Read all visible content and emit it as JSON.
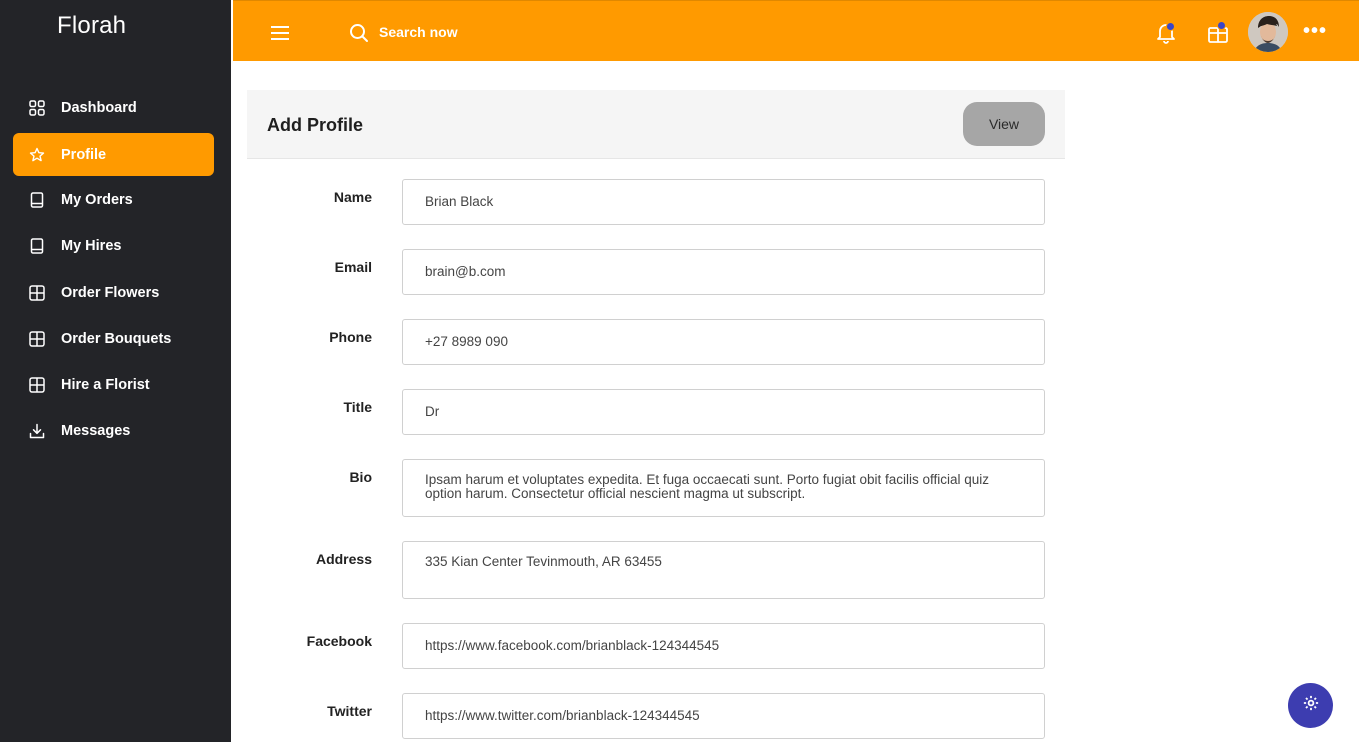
{
  "app": {
    "brand": "Florah"
  },
  "sidebar": {
    "items": [
      {
        "label": "Dashboard",
        "icon": "dashboard-grid-icon",
        "active": false
      },
      {
        "label": "Profile",
        "icon": "star-icon",
        "active": true
      },
      {
        "label": "My Orders",
        "icon": "book-icon",
        "active": false
      },
      {
        "label": "My Hires",
        "icon": "book-icon",
        "active": false
      },
      {
        "label": "Order Flowers",
        "icon": "grid-icon",
        "active": false
      },
      {
        "label": "Order Bouquets",
        "icon": "grid-icon",
        "active": false
      },
      {
        "label": "Hire a Florist",
        "icon": "grid-icon",
        "active": false
      },
      {
        "label": "Messages",
        "icon": "download-icon",
        "active": false
      }
    ]
  },
  "topbar": {
    "search_placeholder": "Search now",
    "more_label": "•••",
    "accent_color": "#ff9a00",
    "badge_color": "#3a45c8"
  },
  "card": {
    "title": "Add Profile",
    "view_button": "View"
  },
  "form": {
    "name": {
      "label": "Name",
      "value": "Brian Black"
    },
    "email": {
      "label": "Email",
      "value": "brain@b.com"
    },
    "phone": {
      "label": "Phone",
      "value": "+27 8989 090"
    },
    "title": {
      "label": "Title",
      "value": "Dr"
    },
    "bio": {
      "label": "Bio",
      "value": " Ipsam harum et voluptates expedita. Et fuga occaecati sunt. Porto fugiat obit facilis official quiz option harum. Consectetur official nescient magma ut subscript."
    },
    "address": {
      "label": "Address",
      "value": "335 Kian Center Tevinmouth, AR 63455"
    },
    "facebook": {
      "label": "Facebook",
      "value": "https://www.facebook.com/brianblack-124344545"
    },
    "twitter": {
      "label": "Twitter",
      "value": "https://www.twitter.com/brianblack-124344545"
    }
  }
}
